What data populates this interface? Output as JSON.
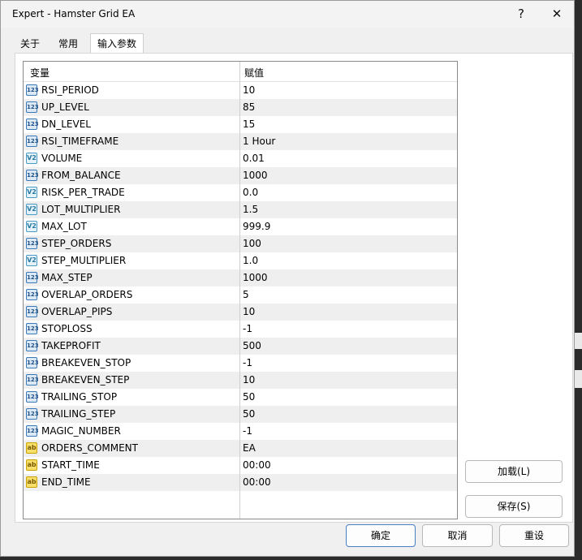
{
  "window": {
    "title": "Expert - Hamster Grid EA",
    "help_label": "?",
    "close_label": "✕"
  },
  "tabs": [
    {
      "label": "关于",
      "active": false
    },
    {
      "label": "常用",
      "active": false
    },
    {
      "label": "输入参数",
      "active": true
    }
  ],
  "table": {
    "headers": {
      "variable": "变量",
      "value": "赋值"
    },
    "icon_labels": {
      "int": "123",
      "double": "V2",
      "string": "ab"
    },
    "rows": [
      {
        "name": "RSI_PERIOD",
        "value": "10",
        "kind": "int"
      },
      {
        "name": "UP_LEVEL",
        "value": "85",
        "kind": "int"
      },
      {
        "name": "DN_LEVEL",
        "value": "15",
        "kind": "int"
      },
      {
        "name": "RSI_TIMEFRAME",
        "value": "1 Hour",
        "kind": "int"
      },
      {
        "name": "VOLUME",
        "value": "0.01",
        "kind": "double"
      },
      {
        "name": "FROM_BALANCE",
        "value": "1000",
        "kind": "int"
      },
      {
        "name": "RISK_PER_TRADE",
        "value": "0.0",
        "kind": "double"
      },
      {
        "name": "LOT_MULTIPLIER",
        "value": "1.5",
        "kind": "double"
      },
      {
        "name": "MAX_LOT",
        "value": "999.9",
        "kind": "double"
      },
      {
        "name": "STEP_ORDERS",
        "value": "100",
        "kind": "int"
      },
      {
        "name": "STEP_MULTIPLIER",
        "value": "1.0",
        "kind": "double"
      },
      {
        "name": "MAX_STEP",
        "value": "1000",
        "kind": "int"
      },
      {
        "name": "OVERLAP_ORDERS",
        "value": "5",
        "kind": "int"
      },
      {
        "name": "OVERLAP_PIPS",
        "value": "10",
        "kind": "int"
      },
      {
        "name": "STOPLOSS",
        "value": "-1",
        "kind": "int"
      },
      {
        "name": "TAKEPROFIT",
        "value": "500",
        "kind": "int"
      },
      {
        "name": "BREAKEVEN_STOP",
        "value": "-1",
        "kind": "int"
      },
      {
        "name": "BREAKEVEN_STEP",
        "value": "10",
        "kind": "int"
      },
      {
        "name": "TRAILING_STOP",
        "value": "50",
        "kind": "int"
      },
      {
        "name": "TRAILING_STEP",
        "value": "50",
        "kind": "int"
      },
      {
        "name": "MAGIC_NUMBER",
        "value": "-1",
        "kind": "int"
      },
      {
        "name": "ORDERS_COMMENT",
        "value": "EA",
        "kind": "string"
      },
      {
        "name": "START_TIME",
        "value": "00:00",
        "kind": "string"
      },
      {
        "name": "END_TIME",
        "value": "00:00",
        "kind": "string"
      }
    ]
  },
  "buttons": {
    "load": "加载(L)",
    "save": "保存(S)",
    "ok": "确定",
    "cancel": "取消",
    "reset": "重设"
  }
}
